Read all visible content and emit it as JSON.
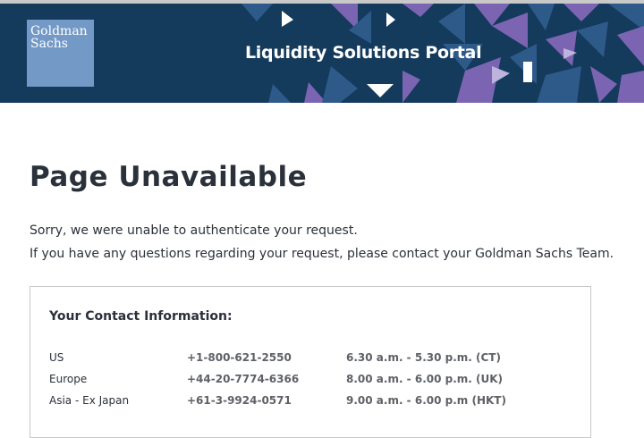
{
  "header": {
    "logo_line1": "Goldman",
    "logo_line2": "Sachs",
    "portal_title": "Liquidity Solutions Portal",
    "colors": {
      "banner": "#143a5c",
      "logo": "#7399c6",
      "pattern_purple": "#7b65b3",
      "pattern_blue": "#2e5a8a"
    }
  },
  "main": {
    "heading": "Page Unavailable",
    "message1": "Sorry, we were unable to authenticate your request.",
    "message2": "If you have any questions regarding your request, please contact your Goldman Sachs Team."
  },
  "contact": {
    "title": "Your Contact Information:",
    "rows": [
      {
        "region": "US",
        "phone": "+1-800-621-2550",
        "hours": "6.30 a.m. - 5.30 p.m. (CT)"
      },
      {
        "region": "Europe",
        "phone": "+44-20-7774-6366",
        "hours": "8.00 a.m. - 6.00 p.m. (UK)"
      },
      {
        "region": "Asia - Ex Japan",
        "phone": "+61-3-9924-0571",
        "hours": "9.00 a.m. - 6.00 p.m (HKT)"
      }
    ]
  }
}
